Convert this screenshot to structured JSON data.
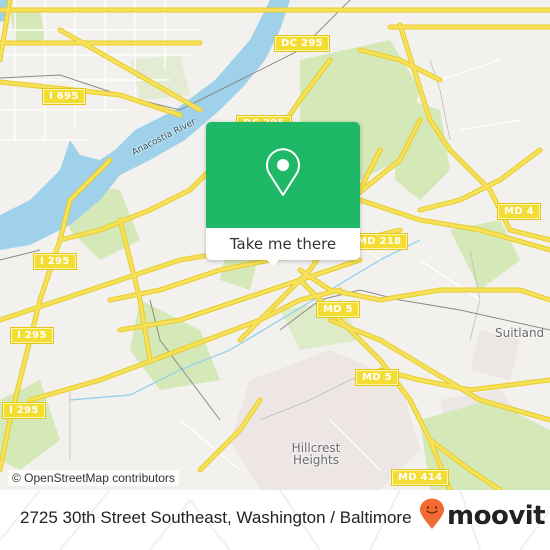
{
  "map": {
    "colors": {
      "background": "#f2f1ee",
      "water": "#9fd2ea",
      "park": "#d4e8b8",
      "road_major": "#f6e15a",
      "road_outline": "#e8cc2a",
      "road_minor": "#ffffff",
      "rail": "#8a8a8a",
      "urban": "#ebe4e2"
    },
    "shields": [
      {
        "id": "i695",
        "label": "I 695"
      },
      {
        "id": "dc295-top",
        "label": "DC 295"
      },
      {
        "id": "dc295-mid",
        "label": "DC 295"
      },
      {
        "id": "md4",
        "label": "MD 4"
      },
      {
        "id": "i295-a",
        "label": "I 295"
      },
      {
        "id": "md218",
        "label": "MD 218"
      },
      {
        "id": "md5-a",
        "label": "MD 5"
      },
      {
        "id": "i295-b",
        "label": "I 295"
      },
      {
        "id": "i295-c",
        "label": "I 295"
      },
      {
        "id": "md5-b",
        "label": "MD 5"
      },
      {
        "id": "md414",
        "label": "MD 414"
      }
    ],
    "places": {
      "suitland": "Suitland",
      "hillcrest_line1": "Hillcrest",
      "hillcrest_line2": "Heights"
    },
    "river_label": "Anacostia River",
    "attribution": "© OpenStreetMap contributors"
  },
  "popup": {
    "accent": "#1eb866",
    "icon": "location-pin-icon",
    "button_label": "Take me there"
  },
  "footer": {
    "address": "2725 30th Street Southeast, Washington / Baltimore",
    "brand": "moovit",
    "brand_color": "#f26a32",
    "brand_icon": "moovit-smiley-pin-icon"
  }
}
